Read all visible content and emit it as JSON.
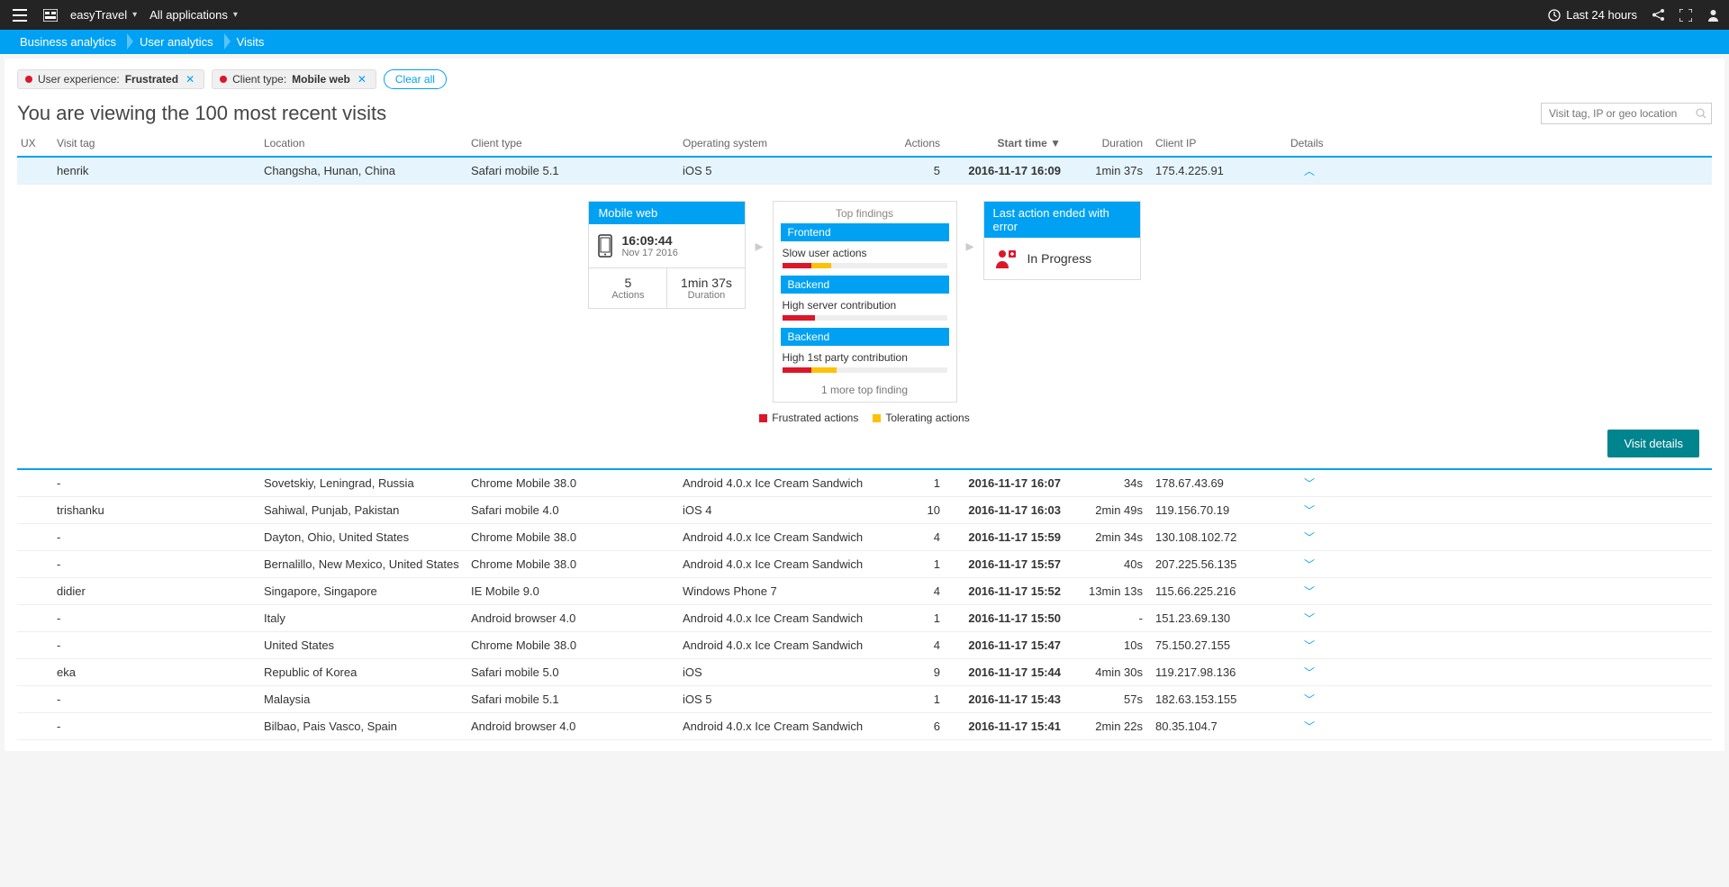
{
  "topbar": {
    "app_name": "easyTravel",
    "all_apps": "All applications",
    "timeframe": "Last 24 hours"
  },
  "breadcrumb": [
    "Business analytics",
    "User analytics",
    "Visits"
  ],
  "filters": {
    "chips": [
      {
        "label": "User experience:",
        "value": "Frustrated"
      },
      {
        "label": "Client type:",
        "value": "Mobile web"
      }
    ],
    "clear_all": "Clear all"
  },
  "heading": "You are viewing the 100 most recent visits",
  "search_placeholder": "Visit tag, IP or geo location",
  "columns": {
    "ux": "UX",
    "tag": "Visit tag",
    "location": "Location",
    "client": "Client type",
    "os": "Operating system",
    "actions": "Actions",
    "start": "Start time ▼",
    "duration": "Duration",
    "ip": "Client IP",
    "details": "Details"
  },
  "expanded_row": {
    "tag": "henrik",
    "location": "Changsha, Hunan, China",
    "client": "Safari mobile 5.1",
    "os": "iOS 5",
    "actions": "5",
    "start": "2016-11-17 16:09",
    "duration": "1min 37s",
    "ip": "175.4.225.91"
  },
  "expand": {
    "mobile_web": {
      "title": "Mobile web",
      "time": "16:09:44",
      "date": "Nov 17 2016",
      "actions_val": "5",
      "actions_lab": "Actions",
      "duration_val": "1min 37s",
      "duration_lab": "Duration"
    },
    "top_findings": {
      "title": "Top findings",
      "items": [
        {
          "head": "Frontend",
          "body": "Slow user actions",
          "red": 18,
          "yel": 12
        },
        {
          "head": "Backend",
          "body": "High server contribution",
          "red": 20,
          "yel": 0
        },
        {
          "head": "Backend",
          "body": "High 1st party contribution",
          "red": 18,
          "yel": 15
        }
      ],
      "more": "1 more top finding"
    },
    "last_action": {
      "title": "Last action ended with error",
      "body": "In Progress"
    },
    "legend": {
      "frustrated": "Frustrated actions",
      "tolerating": "Tolerating actions"
    },
    "visit_details_btn": "Visit details"
  },
  "rows": [
    {
      "tag": "-",
      "location": "Sovetskiy, Leningrad, Russia",
      "client": "Chrome Mobile 38.0",
      "os": "Android 4.0.x Ice Cream Sandwich",
      "actions": "1",
      "start": "2016-11-17 16:07",
      "duration": "34s",
      "ip": "178.67.43.69"
    },
    {
      "tag": "trishanku",
      "location": "Sahiwal, Punjab, Pakistan",
      "client": "Safari mobile 4.0",
      "os": "iOS 4",
      "actions": "10",
      "start": "2016-11-17 16:03",
      "duration": "2min 49s",
      "ip": "119.156.70.19"
    },
    {
      "tag": "-",
      "location": "Dayton, Ohio, United States",
      "client": "Chrome Mobile 38.0",
      "os": "Android 4.0.x Ice Cream Sandwich",
      "actions": "4",
      "start": "2016-11-17 15:59",
      "duration": "2min 34s",
      "ip": "130.108.102.72"
    },
    {
      "tag": "-",
      "location": "Bernalillo, New Mexico, United States",
      "client": "Chrome Mobile 38.0",
      "os": "Android 4.0.x Ice Cream Sandwich",
      "actions": "1",
      "start": "2016-11-17 15:57",
      "duration": "40s",
      "ip": "207.225.56.135"
    },
    {
      "tag": "didier",
      "location": "Singapore, Singapore",
      "client": "IE Mobile 9.0",
      "os": "Windows Phone 7",
      "actions": "4",
      "start": "2016-11-17 15:52",
      "duration": "13min 13s",
      "ip": "115.66.225.216"
    },
    {
      "tag": "-",
      "location": "Italy",
      "client": "Android browser 4.0",
      "os": "Android 4.0.x Ice Cream Sandwich",
      "actions": "1",
      "start": "2016-11-17 15:50",
      "duration": "-",
      "ip": "151.23.69.130"
    },
    {
      "tag": "-",
      "location": "United States",
      "client": "Chrome Mobile 38.0",
      "os": "Android 4.0.x Ice Cream Sandwich",
      "actions": "4",
      "start": "2016-11-17 15:47",
      "duration": "10s",
      "ip": "75.150.27.155"
    },
    {
      "tag": "eka",
      "location": "Republic of Korea",
      "client": "Safari mobile 5.0",
      "os": "iOS",
      "actions": "9",
      "start": "2016-11-17 15:44",
      "duration": "4min 30s",
      "ip": "119.217.98.136"
    },
    {
      "tag": "-",
      "location": "Malaysia",
      "client": "Safari mobile 5.1",
      "os": "iOS 5",
      "actions": "1",
      "start": "2016-11-17 15:43",
      "duration": "57s",
      "ip": "182.63.153.155"
    },
    {
      "tag": "-",
      "location": "Bilbao, Pais Vasco, Spain",
      "client": "Android browser 4.0",
      "os": "Android 4.0.x Ice Cream Sandwich",
      "actions": "6",
      "start": "2016-11-17 15:41",
      "duration": "2min 22s",
      "ip": "80.35.104.7"
    }
  ]
}
